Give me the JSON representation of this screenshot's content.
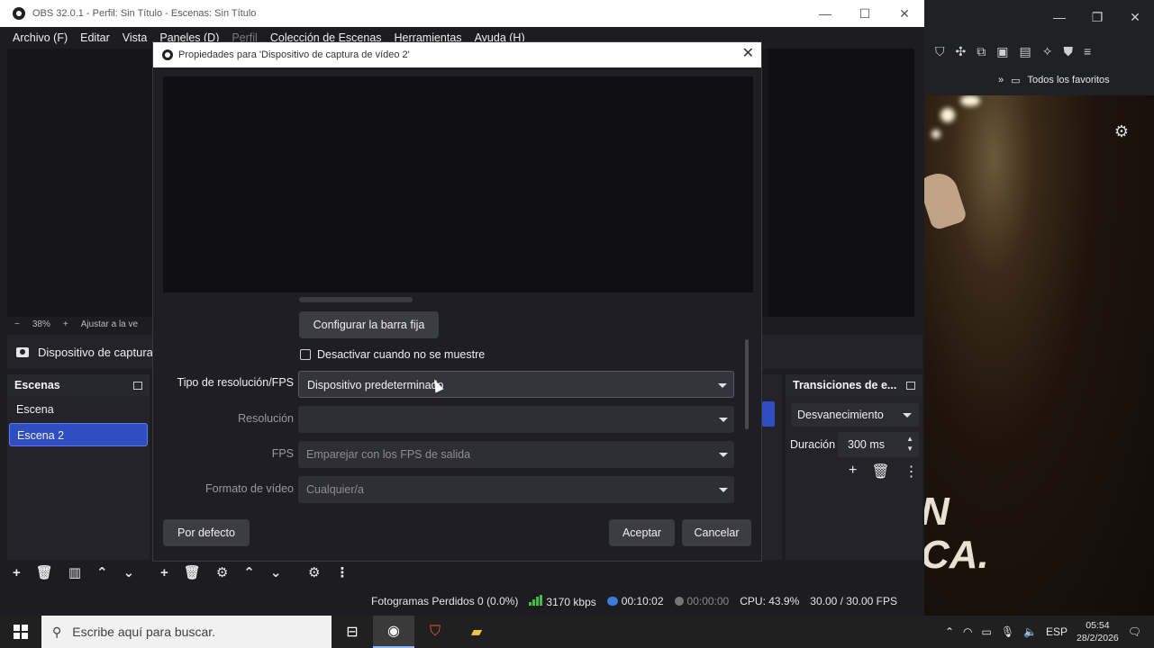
{
  "browser": {
    "favorites_label": "Todos los favoritos",
    "overlay_text_1": "N",
    "overlay_text_2": "CA."
  },
  "obs": {
    "title": "OBS 32.0.1 - Perfil: Sin Título - Escenas: Sin Título",
    "menu": [
      "Archivo (F)",
      "Editar",
      "Vista",
      "Paneles (D)",
      "Perfil",
      "Colección de Escenas",
      "Herramientas",
      "Ayuda (H)"
    ],
    "zoom": "38%",
    "fit_label": "Ajustar a la ve",
    "source_name": "Dispositivo de captura",
    "scenes_title": "Escenas",
    "scenes": [
      "Escena",
      "Escena 2"
    ],
    "transitions_title": "Transiciones de e...",
    "transition_value": "Desvanecimiento",
    "duration_label": "Duración",
    "duration_value": "300 ms",
    "status": {
      "dropped": "Fotogramas Perdidos 0 (0.0%)",
      "bitrate": "3170 kbps",
      "stream_time": "00:10:02",
      "rec_time": "00:00:00",
      "cpu": "CPU: 43.9%",
      "fps": "30.00 / 30.00 FPS"
    }
  },
  "dialog": {
    "title": "Propiedades para 'Dispositivo de captura de vídeo 2'",
    "config_button": "Configurar la barra fija",
    "deactivate_label": "Desactivar cuando no se muestre",
    "deactivate_checked": false,
    "res_type_label": "Tipo de resolución/FPS",
    "res_type_value": "Dispositivo predeterminado",
    "resolution_label": "Resolución",
    "resolution_value": "",
    "fps_label": "FPS",
    "fps_value": "Emparejar con los FPS de salida",
    "format_label": "Formato de vídeo",
    "format_value": "Cualquier/a",
    "defaults_button": "Por defecto",
    "ok_button": "Aceptar",
    "cancel_button": "Cancelar"
  },
  "taskbar": {
    "search_placeholder": "Escribe aquí para buscar.",
    "lang": "ESP",
    "time": "05:54",
    "date": "28/2/2026"
  }
}
